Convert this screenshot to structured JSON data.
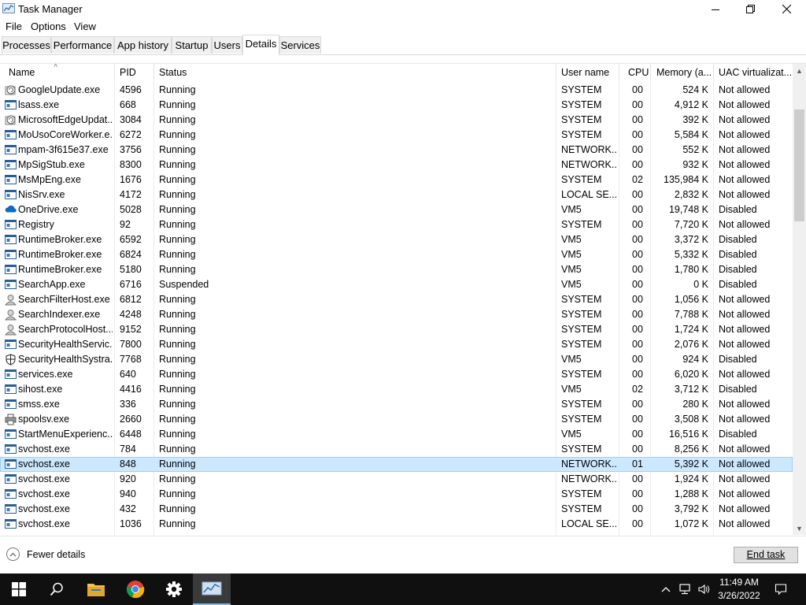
{
  "window": {
    "title": "Task Manager"
  },
  "menu": [
    "File",
    "Options",
    "View"
  ],
  "tabs": [
    {
      "label": "Processes",
      "active": false
    },
    {
      "label": "Performance",
      "active": false
    },
    {
      "label": "App history",
      "active": false
    },
    {
      "label": "Startup",
      "active": false
    },
    {
      "label": "Users",
      "active": false
    },
    {
      "label": "Details",
      "active": true
    },
    {
      "label": "Services",
      "active": false
    }
  ],
  "columns": [
    "Name",
    "PID",
    "Status",
    "User name",
    "CPU",
    "Memory (a...",
    "UAC virtualizat..."
  ],
  "rows": [
    {
      "icon": "update-icon",
      "name": "GoogleUpdate.exe",
      "pid": "4596",
      "status": "Running",
      "user": "SYSTEM",
      "cpu": "00",
      "mem": "524 K",
      "uac": "Not allowed"
    },
    {
      "icon": "app-icon",
      "name": "lsass.exe",
      "pid": "668",
      "status": "Running",
      "user": "SYSTEM",
      "cpu": "00",
      "mem": "4,912 K",
      "uac": "Not allowed"
    },
    {
      "icon": "update-icon",
      "name": "MicrosoftEdgeUpdat...",
      "pid": "3084",
      "status": "Running",
      "user": "SYSTEM",
      "cpu": "00",
      "mem": "392 K",
      "uac": "Not allowed"
    },
    {
      "icon": "app-icon",
      "name": "MoUsoCoreWorker.e...",
      "pid": "6272",
      "status": "Running",
      "user": "SYSTEM",
      "cpu": "00",
      "mem": "5,584 K",
      "uac": "Not allowed"
    },
    {
      "icon": "app-icon",
      "name": "mpam-3f615e37.exe",
      "pid": "3756",
      "status": "Running",
      "user": "NETWORK...",
      "cpu": "00",
      "mem": "552 K",
      "uac": "Not allowed"
    },
    {
      "icon": "app-icon",
      "name": "MpSigStub.exe",
      "pid": "8300",
      "status": "Running",
      "user": "NETWORK...",
      "cpu": "00",
      "mem": "932 K",
      "uac": "Not allowed"
    },
    {
      "icon": "app-icon",
      "name": "MsMpEng.exe",
      "pid": "1676",
      "status": "Running",
      "user": "SYSTEM",
      "cpu": "02",
      "mem": "135,984 K",
      "uac": "Not allowed"
    },
    {
      "icon": "app-icon",
      "name": "NisSrv.exe",
      "pid": "4172",
      "status": "Running",
      "user": "LOCAL SE...",
      "cpu": "00",
      "mem": "2,832 K",
      "uac": "Not allowed"
    },
    {
      "icon": "onedrive-icon",
      "name": "OneDrive.exe",
      "pid": "5028",
      "status": "Running",
      "user": "VM5",
      "cpu": "00",
      "mem": "19,748 K",
      "uac": "Disabled"
    },
    {
      "icon": "app-icon",
      "name": "Registry",
      "pid": "92",
      "status": "Running",
      "user": "SYSTEM",
      "cpu": "00",
      "mem": "7,720 K",
      "uac": "Not allowed"
    },
    {
      "icon": "app-icon",
      "name": "RuntimeBroker.exe",
      "pid": "6592",
      "status": "Running",
      "user": "VM5",
      "cpu": "00",
      "mem": "3,372 K",
      "uac": "Disabled"
    },
    {
      "icon": "app-icon",
      "name": "RuntimeBroker.exe",
      "pid": "6824",
      "status": "Running",
      "user": "VM5",
      "cpu": "00",
      "mem": "5,332 K",
      "uac": "Disabled"
    },
    {
      "icon": "app-icon",
      "name": "RuntimeBroker.exe",
      "pid": "5180",
      "status": "Running",
      "user": "VM5",
      "cpu": "00",
      "mem": "1,780 K",
      "uac": "Disabled"
    },
    {
      "icon": "app-icon",
      "name": "SearchApp.exe",
      "pid": "6716",
      "status": "Suspended",
      "user": "VM5",
      "cpu": "00",
      "mem": "0 K",
      "uac": "Disabled"
    },
    {
      "icon": "user-icon",
      "name": "SearchFilterHost.exe",
      "pid": "6812",
      "status": "Running",
      "user": "SYSTEM",
      "cpu": "00",
      "mem": "1,056 K",
      "uac": "Not allowed"
    },
    {
      "icon": "user-icon",
      "name": "SearchIndexer.exe",
      "pid": "4248",
      "status": "Running",
      "user": "SYSTEM",
      "cpu": "00",
      "mem": "7,788 K",
      "uac": "Not allowed"
    },
    {
      "icon": "user-icon",
      "name": "SearchProtocolHost....",
      "pid": "9152",
      "status": "Running",
      "user": "SYSTEM",
      "cpu": "00",
      "mem": "1,724 K",
      "uac": "Not allowed"
    },
    {
      "icon": "app-icon",
      "name": "SecurityHealthServic...",
      "pid": "7800",
      "status": "Running",
      "user": "SYSTEM",
      "cpu": "00",
      "mem": "2,076 K",
      "uac": "Not allowed"
    },
    {
      "icon": "shield-icon",
      "name": "SecurityHealthSystra...",
      "pid": "7768",
      "status": "Running",
      "user": "VM5",
      "cpu": "00",
      "mem": "924 K",
      "uac": "Disabled"
    },
    {
      "icon": "app-icon",
      "name": "services.exe",
      "pid": "640",
      "status": "Running",
      "user": "SYSTEM",
      "cpu": "00",
      "mem": "6,020 K",
      "uac": "Not allowed"
    },
    {
      "icon": "app-icon",
      "name": "sihost.exe",
      "pid": "4416",
      "status": "Running",
      "user": "VM5",
      "cpu": "02",
      "mem": "3,712 K",
      "uac": "Disabled"
    },
    {
      "icon": "app-icon",
      "name": "smss.exe",
      "pid": "336",
      "status": "Running",
      "user": "SYSTEM",
      "cpu": "00",
      "mem": "280 K",
      "uac": "Not allowed"
    },
    {
      "icon": "printer-icon",
      "name": "spoolsv.exe",
      "pid": "2660",
      "status": "Running",
      "user": "SYSTEM",
      "cpu": "00",
      "mem": "3,508 K",
      "uac": "Not allowed"
    },
    {
      "icon": "app-icon",
      "name": "StartMenuExperienc...",
      "pid": "6448",
      "status": "Running",
      "user": "VM5",
      "cpu": "00",
      "mem": "16,516 K",
      "uac": "Disabled"
    },
    {
      "icon": "app-icon",
      "name": "svchost.exe",
      "pid": "784",
      "status": "Running",
      "user": "SYSTEM",
      "cpu": "00",
      "mem": "8,256 K",
      "uac": "Not allowed"
    },
    {
      "icon": "app-icon",
      "name": "svchost.exe",
      "pid": "848",
      "status": "Running",
      "user": "NETWORK...",
      "cpu": "01",
      "mem": "5,392 K",
      "uac": "Not allowed",
      "selected": true
    },
    {
      "icon": "app-icon",
      "name": "svchost.exe",
      "pid": "920",
      "status": "Running",
      "user": "NETWORK...",
      "cpu": "00",
      "mem": "1,924 K",
      "uac": "Not allowed"
    },
    {
      "icon": "app-icon",
      "name": "svchost.exe",
      "pid": "940",
      "status": "Running",
      "user": "SYSTEM",
      "cpu": "00",
      "mem": "1,288 K",
      "uac": "Not allowed"
    },
    {
      "icon": "app-icon",
      "name": "svchost.exe",
      "pid": "432",
      "status": "Running",
      "user": "SYSTEM",
      "cpu": "00",
      "mem": "3,792 K",
      "uac": "Not allowed"
    },
    {
      "icon": "app-icon",
      "name": "svchost.exe",
      "pid": "1036",
      "status": "Running",
      "user": "LOCAL SE...",
      "cpu": "00",
      "mem": "1,072 K",
      "uac": "Not allowed"
    }
  ],
  "footer": {
    "fewer_details": "Fewer details",
    "end_task": "End task"
  },
  "taskbar": {
    "apps": [
      "start-icon",
      "search-icon",
      "file-explorer-icon",
      "chrome-icon",
      "settings-icon",
      "task-manager-icon"
    ],
    "active_app": "task-manager-icon",
    "time": "11:49 AM",
    "date": "3/26/2022"
  },
  "colors": {
    "selection": "#cce8ff",
    "selection_border": "#99d1ff",
    "taskbar": "#101010",
    "accent": "#76b9ed"
  }
}
